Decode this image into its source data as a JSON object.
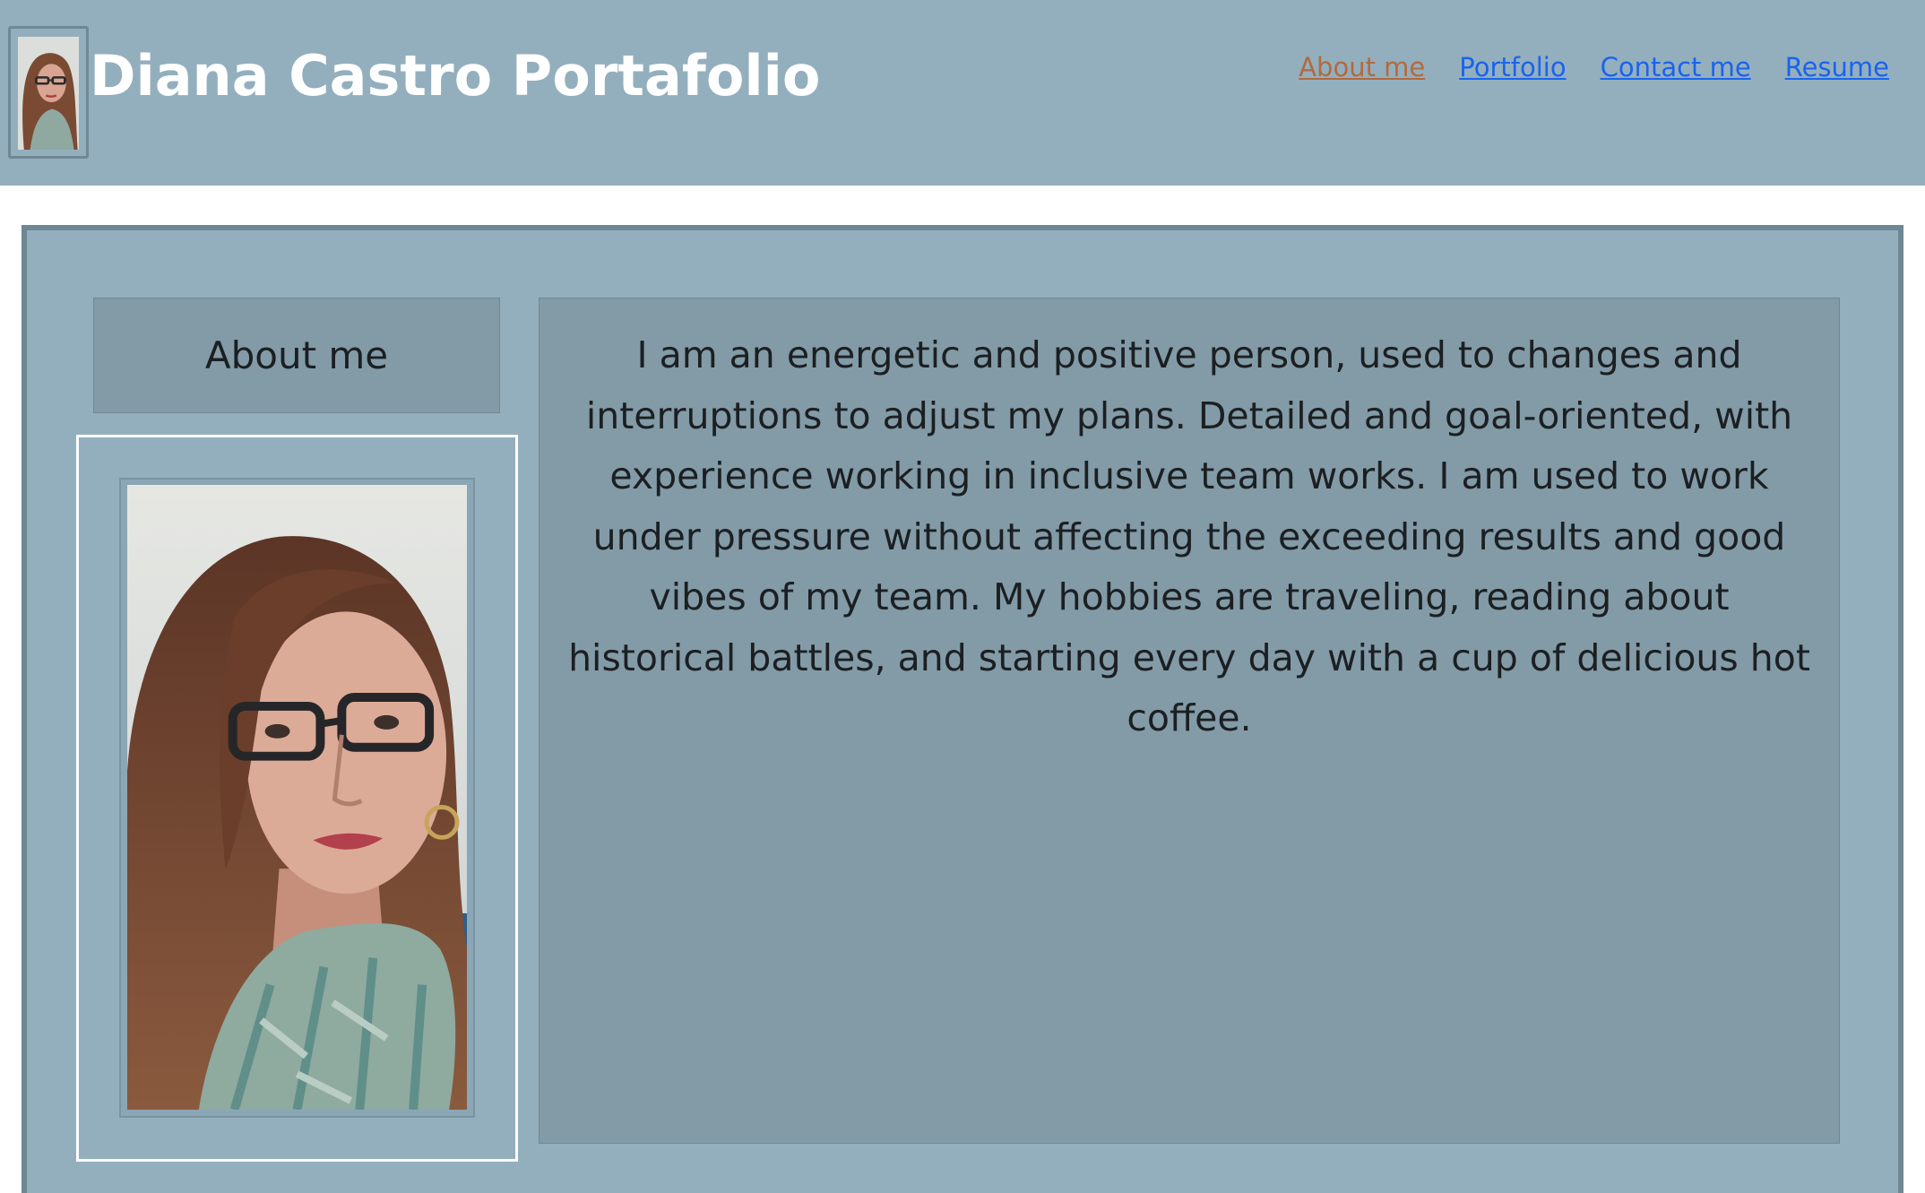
{
  "header": {
    "title": "Diana Castro Portafolio",
    "logo_icon": "portrait-photo-icon",
    "nav": [
      {
        "label": "About me",
        "active": true
      },
      {
        "label": "Portfolio",
        "active": false
      },
      {
        "label": "Contact me",
        "active": false
      },
      {
        "label": "Resume",
        "active": false
      }
    ]
  },
  "about": {
    "heading": "About me",
    "photo_icon": "portrait-photo-icon",
    "text": "I am an energetic and positive person, used to changes and interruptions to adjust my plans. Detailed and goal-oriented, with experience working in inclusive team works. I am used to work under pressure without affecting the exceeding results and good vibes of my team. My hobbies are traveling, reading about historical battles, and starting every day with a cup of delicious hot coffee."
  },
  "colors": {
    "header_bg": "#93afbe",
    "panel_bg": "#829ba7",
    "border": "#6e8793",
    "link": "#1a63ef",
    "link_active": "#b36a3e",
    "title": "#ffffff",
    "text": "#1c1f22"
  }
}
